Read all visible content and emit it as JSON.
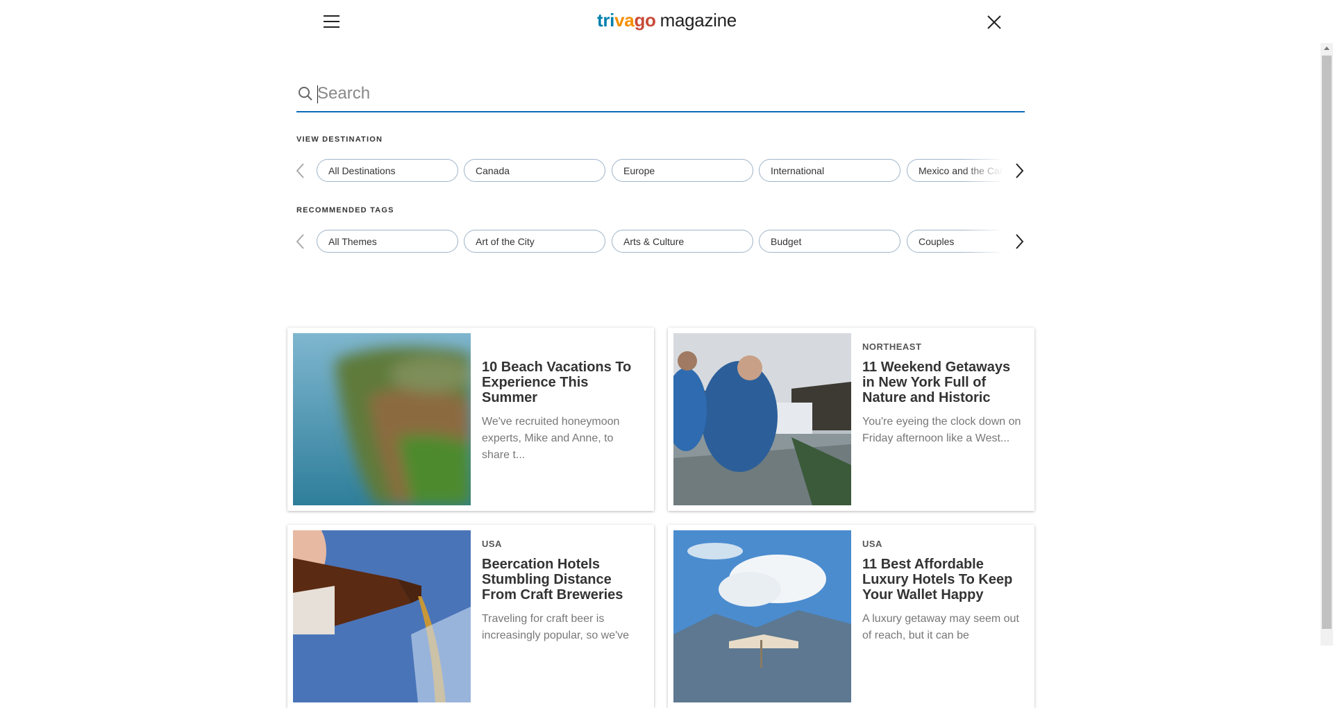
{
  "header": {
    "logo": {
      "part1": "tri",
      "part2": "va",
      "part3": "go",
      "part4": "magazine"
    },
    "menu_icon": "hamburger-icon",
    "close_icon": "close-icon"
  },
  "search": {
    "placeholder": "Search",
    "value": ""
  },
  "destinations": {
    "label": "VIEW DESTINATION",
    "items": [
      "All Destinations",
      "Canada",
      "Europe",
      "International",
      "Mexico and the Caribbean"
    ]
  },
  "tags": {
    "label": "RECOMMENDED TAGS",
    "items": [
      "All Themes",
      "Art of the City",
      "Arts & Culture",
      "Budget",
      "Couples"
    ]
  },
  "articles": [
    {
      "category": "",
      "title": "10 Beach Vacations To Experience This Summer",
      "description": "We've recruited honeymoon experts, Mike and Anne, to share t..."
    },
    {
      "category": "NORTHEAST",
      "title": "11 Weekend Getaways in New York Full of Nature and Historic",
      "description": "You're eyeing the clock down on Friday afternoon like a West..."
    },
    {
      "category": "USA",
      "title": "Beercation Hotels Stumbling Distance From Craft Breweries",
      "description": "Traveling for craft beer is increasingly popular, so we've"
    },
    {
      "category": "USA",
      "title": "11 Best Affordable Luxury Hotels To Keep Your Wallet Happy",
      "description": "A luxury getaway may seem out of reach, but it can be"
    }
  ],
  "colors": {
    "brand_blue": "#007fad",
    "brand_orange": "#f48f00",
    "brand_red": "#c94a38",
    "search_underline": "#0a6ab6",
    "chip_border": "#9fb3c8"
  }
}
